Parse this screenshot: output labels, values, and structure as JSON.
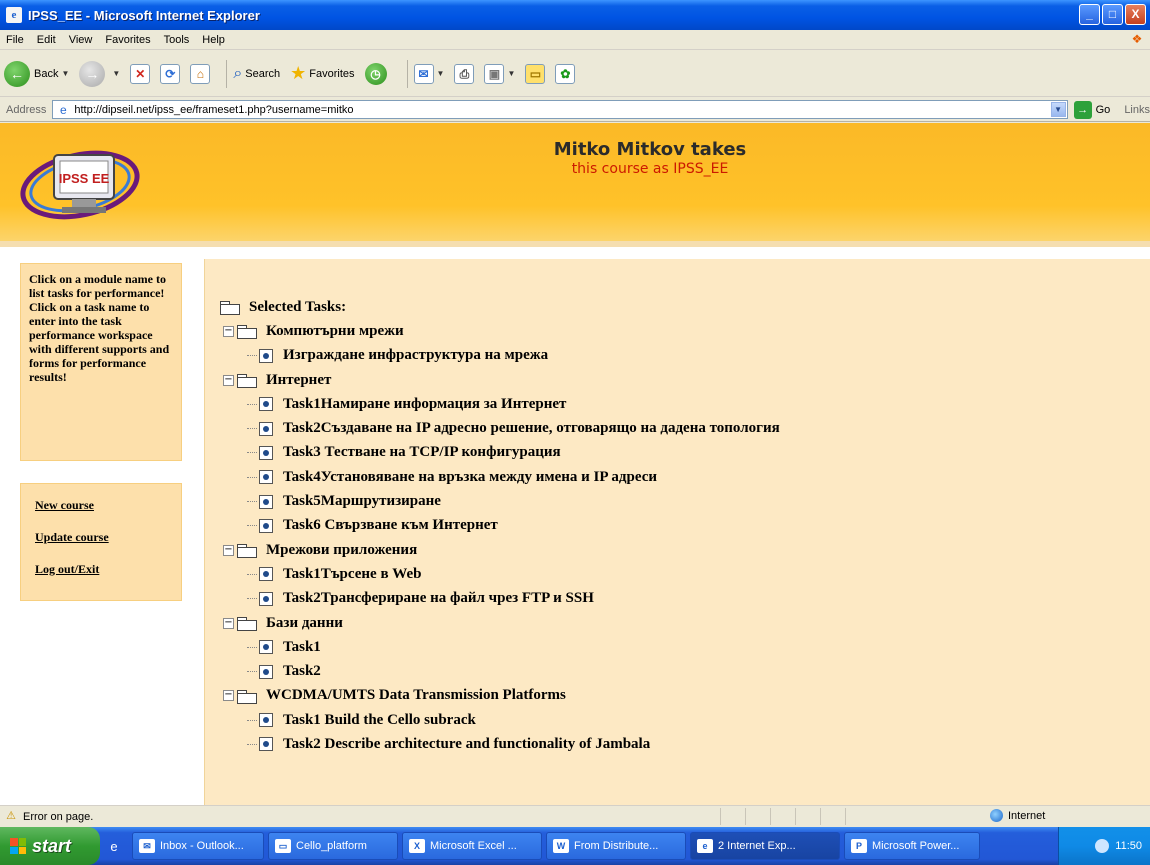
{
  "window": {
    "title": "IPSS_EE - Microsoft Internet Explorer",
    "controls": {
      "minimize": "_",
      "maximize": "□",
      "close": "X"
    }
  },
  "menubar": [
    "File",
    "Edit",
    "View",
    "Favorites",
    "Tools",
    "Help"
  ],
  "toolbar": {
    "back": "Back",
    "search": "Search",
    "favorites": "Favorites"
  },
  "address": {
    "label": "Address",
    "url": "http://dipseil.net/ipss_ee/frameset1.php?username=mitko",
    "go": "Go",
    "links": "Links"
  },
  "header": {
    "logo_text": "IPSS EE",
    "line1": "Mitko Mitkov takes",
    "line2": "this course as IPSS_EE"
  },
  "sidebar": {
    "help_text": "Click on a module name to list tasks for performance! Click on a task name to enter into the task performance workspace with different supports and forms for performance results!",
    "links": [
      {
        "label": "New course"
      },
      {
        "label": "Update course"
      },
      {
        "label": "Log out/Exit"
      }
    ]
  },
  "tree": {
    "root": "Selected Tasks:",
    "modules": [
      {
        "name": "Компютърни мрежи",
        "tasks": [
          "Изграждане инфраструктура на мрежа"
        ]
      },
      {
        "name": "Интернет",
        "tasks": [
          "Task1Намиране информация за Интернет",
          "Task2Създаване на IP адресно решение, отговарящо на дадена топология",
          "Task3 Тестване на TCP/IP конфигурация",
          "Task4Установяване на връзка между имена и IP адреси",
          "Task5Маршрутизиране",
          "Task6 Свързване към Интернет"
        ]
      },
      {
        "name": "Мрежови приложения",
        "tasks": [
          "Task1Търсене в Web",
          "Task2Трансфериране на файл чрез FTP и SSH"
        ]
      },
      {
        "name": "Бази данни",
        "tasks": [
          "Task1",
          "Task2"
        ]
      },
      {
        "name": "WCDMA/UMTS Data Transmission Platforms",
        "tasks": [
          "Task1 Build the Cello subrack",
          "Task2 Describe architecture and functionality of Jambala"
        ]
      }
    ]
  },
  "statusbar": {
    "message": "Error on page.",
    "zone": "Internet"
  },
  "taskbar": {
    "start": "start",
    "items": [
      {
        "label": "Inbox - Outlook...",
        "icon": "mail-icon"
      },
      {
        "label": "Cello_platform",
        "icon": "folder-icon"
      },
      {
        "label": "Microsoft Excel ...",
        "icon": "excel-icon"
      },
      {
        "label": "From Distribute...",
        "icon": "word-icon"
      },
      {
        "label": "2 Internet Exp...",
        "icon": "ie-icon",
        "active": true
      },
      {
        "label": "Microsoft Power...",
        "icon": "powerpoint-icon"
      }
    ],
    "clock": "11:50"
  }
}
